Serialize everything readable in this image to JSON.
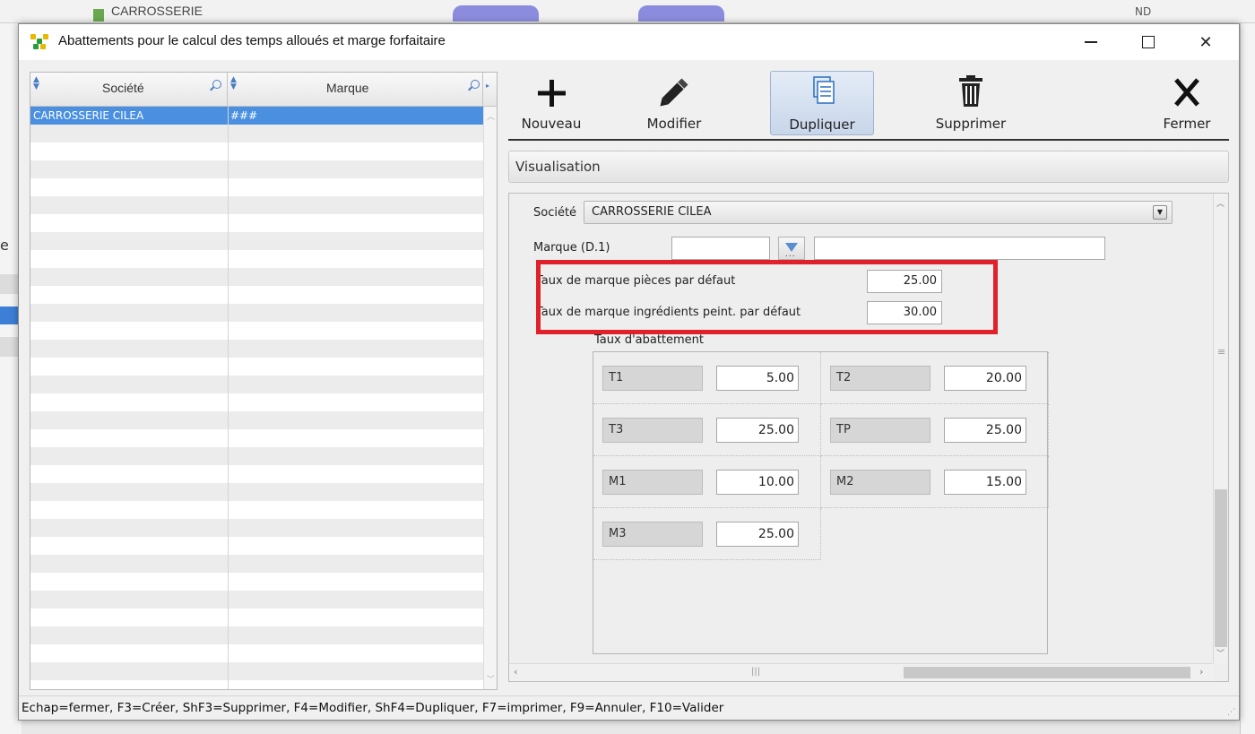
{
  "background": {
    "top_text": "CARROSSERIE",
    "top_right_text": "ND",
    "left_letter": "e"
  },
  "window": {
    "title": "Abattements pour le calcul des temps alloués et marge forfaitaire",
    "minimize_icon": "minimize-icon",
    "maximize_icon": "maximize-icon",
    "close_symbol": "✕"
  },
  "grid": {
    "columns": [
      "Société",
      "Marque"
    ],
    "rows": [
      {
        "societe": "CARROSSERIE CILEA",
        "marque": "###",
        "selected": true
      }
    ],
    "selected_color": "#4a8fe0"
  },
  "toolbar": {
    "nouveau": "Nouveau",
    "modifier": "Modifier",
    "dupliquer": "Dupliquer",
    "supprimer": "Supprimer",
    "fermer": "Fermer"
  },
  "visualisation": {
    "header": "Visualisation",
    "societe_label": "Société",
    "societe_value": "CARROSSERIE CILEA",
    "marque_label": "Marque (D.1)",
    "marque_code": "",
    "marque_name": "",
    "taux_pieces_label": "Taux de marque pièces par défaut",
    "taux_pieces_value": "25.00",
    "taux_ingredients_label": "Taux de marque ingrédients peint. par défaut",
    "taux_ingredients_value": "30.00",
    "highlight_color": "#e0202a",
    "abattement_title": "Taux d'abattement",
    "abattements": [
      {
        "code": "T1",
        "value": "5.00"
      },
      {
        "code": "T2",
        "value": "20.00"
      },
      {
        "code": "T3",
        "value": "25.00"
      },
      {
        "code": "TP",
        "value": "25.00"
      },
      {
        "code": "M1",
        "value": "10.00"
      },
      {
        "code": "M2",
        "value": "15.00"
      },
      {
        "code": "M3",
        "value": "25.00"
      }
    ]
  },
  "statusbar": {
    "text": "Echap=fermer, F3=Créer, ShF3=Supprimer, F4=Modifier, ShF4=Dupliquer, F7=imprimer, F9=Annuler, F10=Valider"
  }
}
